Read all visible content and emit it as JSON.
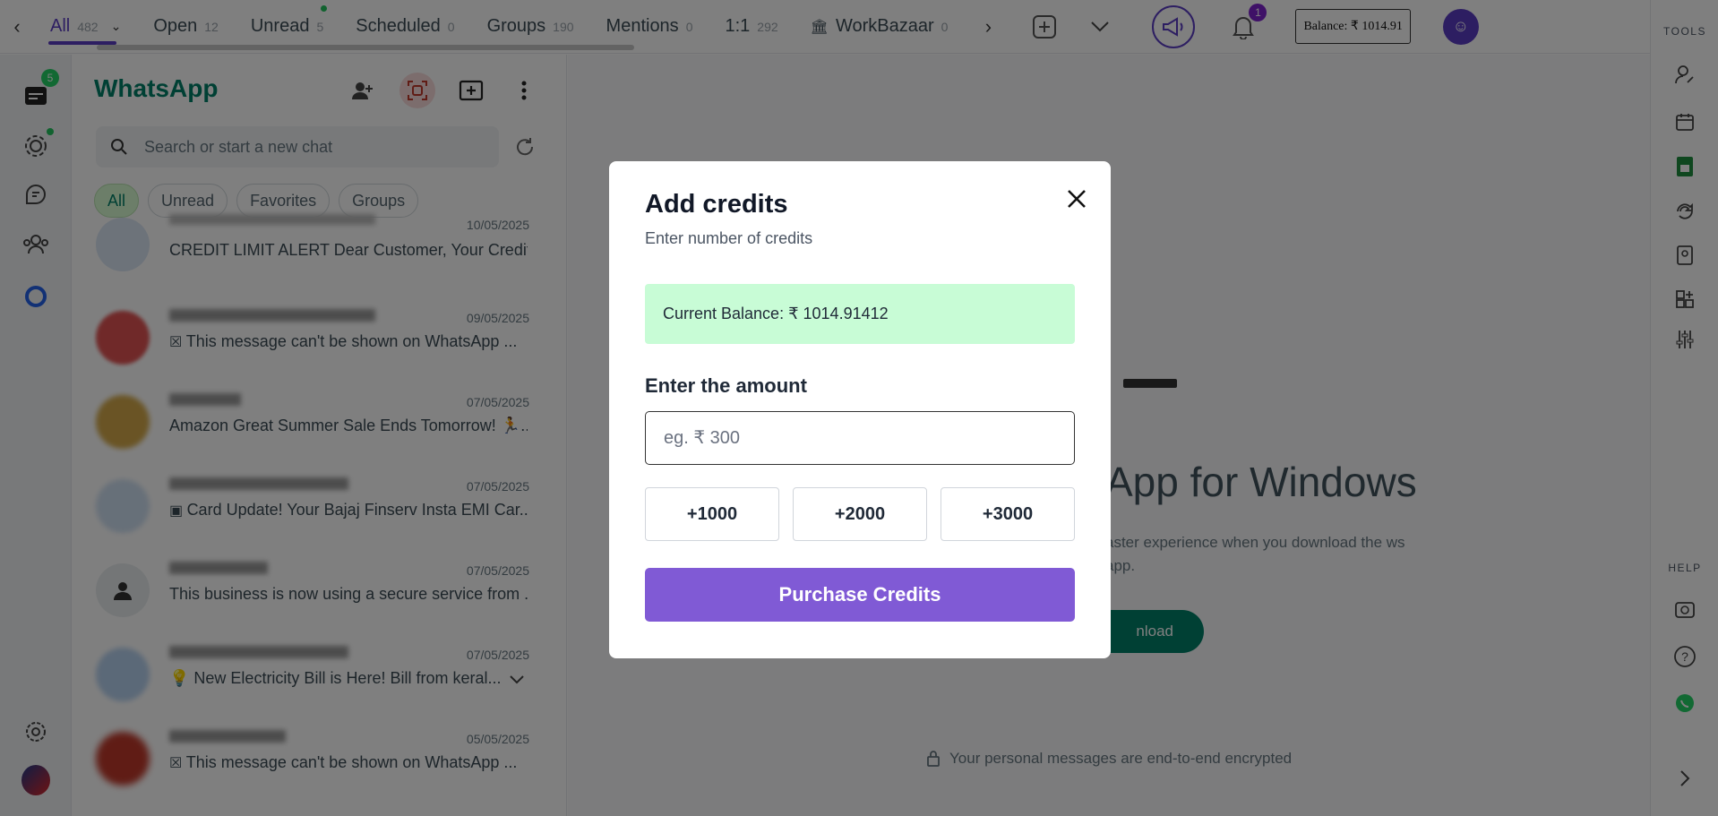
{
  "tabs": [
    {
      "label": "All",
      "count": "482"
    },
    {
      "label": "Open",
      "count": "12"
    },
    {
      "label": "Unread",
      "count": "5"
    },
    {
      "label": "Scheduled",
      "count": "0"
    },
    {
      "label": "Groups",
      "count": "190"
    },
    {
      "label": "Mentions",
      "count": "0"
    },
    {
      "label": "1:1",
      "count": "292"
    },
    {
      "label": "WorkBazaar",
      "count": "0"
    }
  ],
  "topbar": {
    "notification_count": "1",
    "balance": "Balance: ₹ 1014.91"
  },
  "left_rail": {
    "inbox_badge": "5"
  },
  "tools_rail": {
    "tools_label": "TOOLS",
    "help_label": "HELP"
  },
  "chat_panel": {
    "title": "WhatsApp",
    "search_placeholder": "Search or start a new chat",
    "filters": [
      "All",
      "Unread",
      "Favorites",
      "Groups"
    ],
    "chats": [
      {
        "date": "10/05/2025",
        "preview": "CREDIT LIMIT ALERT Dear Customer, Your Credit ..."
      },
      {
        "date": "09/05/2025",
        "preview": "This message can't be shown on WhatsApp ..."
      },
      {
        "date": "07/05/2025",
        "preview": "Amazon Great Summer Sale Ends Tomorrow! 🏃..."
      },
      {
        "date": "07/05/2025",
        "preview": "Card Update! Your Bajaj Finserv Insta EMI Car..."
      },
      {
        "date": "07/05/2025",
        "preview": "This business is now using a secure service from ..."
      },
      {
        "date": "07/05/2025",
        "preview": "💡 New Electricity Bill is Here! Bill from keral..."
      },
      {
        "date": "05/05/2025",
        "preview": "This message can't be shown on WhatsApp ..."
      }
    ]
  },
  "main": {
    "intro_title": "App for Windows",
    "intro_sub": "aster experience when you download the ws app.",
    "download_label": "nload",
    "encryption_note": "Your personal messages are end-to-end encrypted"
  },
  "modal": {
    "title": "Add credits",
    "subtitle": "Enter number of credits",
    "current_balance": "Current Balance: ₹ 1014.91412",
    "amount_label": "Enter the amount",
    "amount_placeholder": "eg. ₹ 300",
    "quick_amounts": [
      "+1000",
      "+2000",
      "+3000"
    ],
    "purchase_label": "Purchase Credits"
  },
  "colors": {
    "brand_green": "#008069",
    "accent_purple": "#805ad5",
    "balance_bg": "#c8fcd6"
  }
}
